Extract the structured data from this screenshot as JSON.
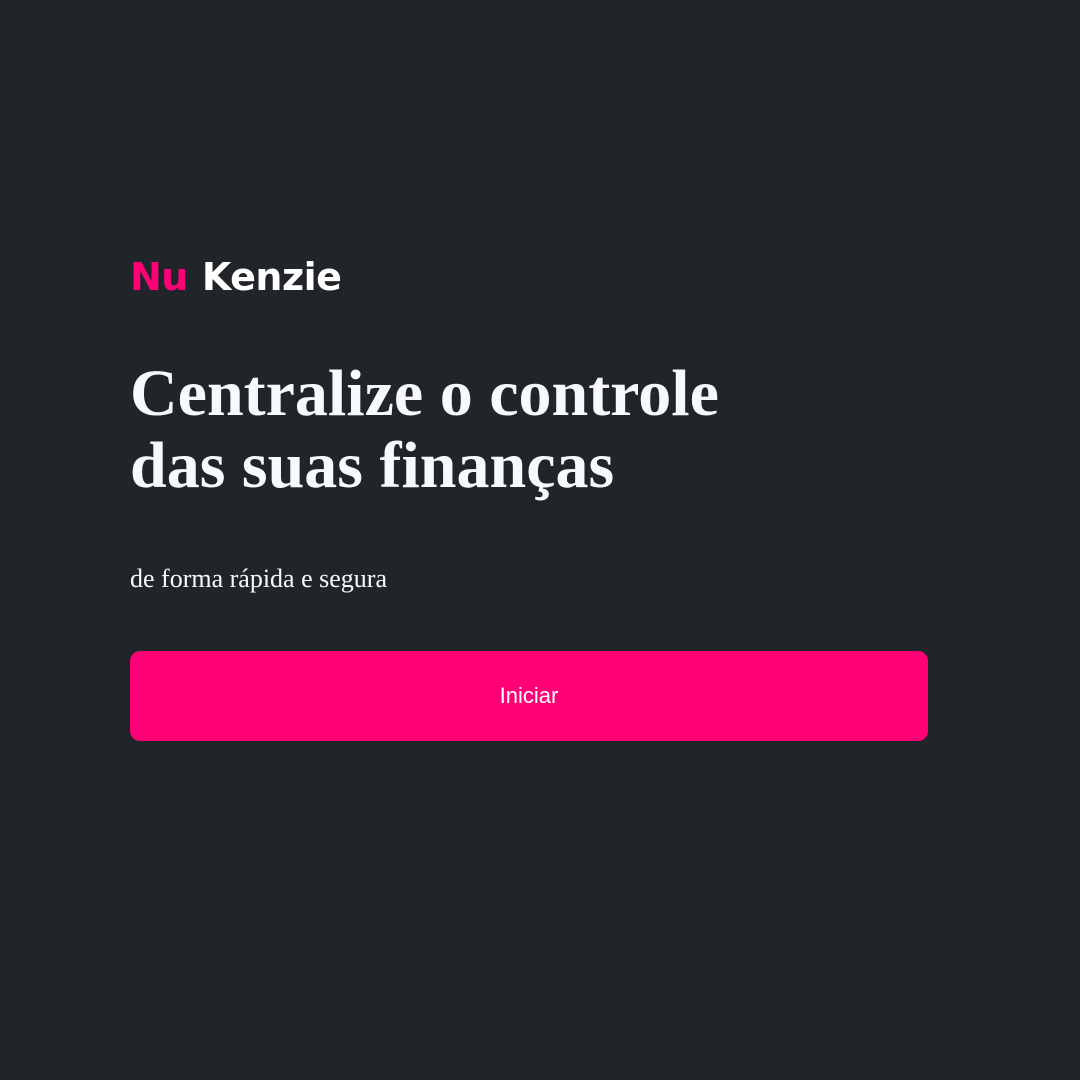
{
  "logo": {
    "part1": "Nu",
    "part2": "Kenzie"
  },
  "hero": {
    "headline_line1": "Centralize o controle",
    "headline_line2": "das suas finanças",
    "subtitle": "de forma rápida e segura",
    "button_label": "Iniciar"
  },
  "colors": {
    "background": "#212529",
    "accent": "#FF0077",
    "text": "#F8F9FA"
  }
}
